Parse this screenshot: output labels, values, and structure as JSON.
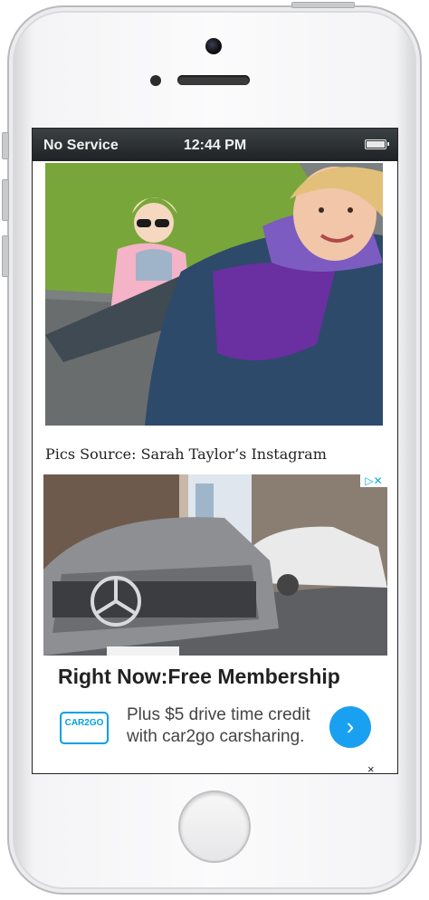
{
  "status_bar": {
    "carrier": "No Service",
    "time": "12:44 PM"
  },
  "article": {
    "caption": "Pics Source: Sarah Taylor’s Instagram"
  },
  "ad": {
    "headline": "Right Now:Free Membership",
    "body": "Plus $5 drive time credit with car2go carsharing.",
    "logo_text": "CAR2GO",
    "cta_icon": "chevron-right-icon",
    "brand_color": "#1aa0f1"
  }
}
